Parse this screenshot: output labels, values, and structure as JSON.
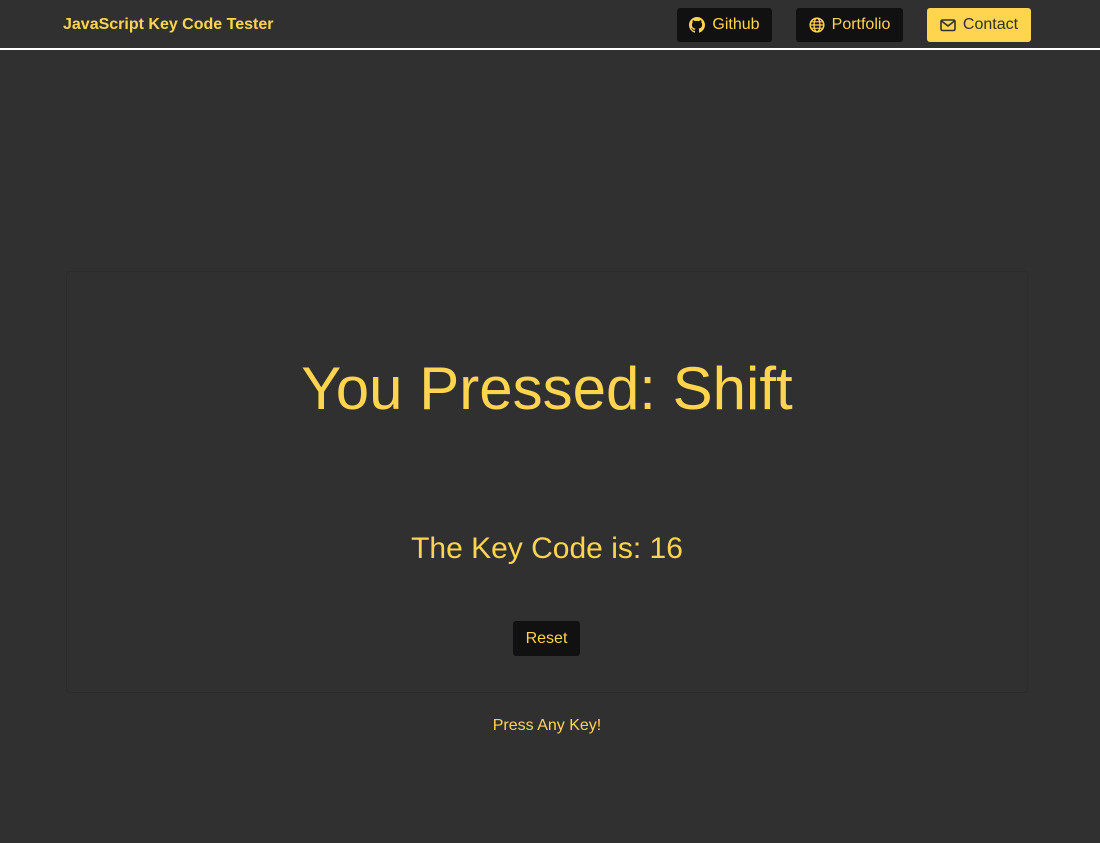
{
  "navbar": {
    "brand": "JavaScript Key Code Tester",
    "buttons": [
      {
        "label": "Github",
        "icon": "github-icon"
      },
      {
        "label": "Portfolio",
        "icon": "globe-icon"
      },
      {
        "label": "Contact",
        "icon": "envelope-icon"
      }
    ]
  },
  "main": {
    "pressed_text": "You Pressed: Shift",
    "keycode_text": "The Key Code is: 16",
    "reset_label": "Reset"
  },
  "footer": {
    "hint": "Press Any Key!"
  },
  "colors": {
    "background": "#303030",
    "accent": "#ffd54f",
    "button_dark": "#111111",
    "navbar_border": "#ffffff"
  }
}
